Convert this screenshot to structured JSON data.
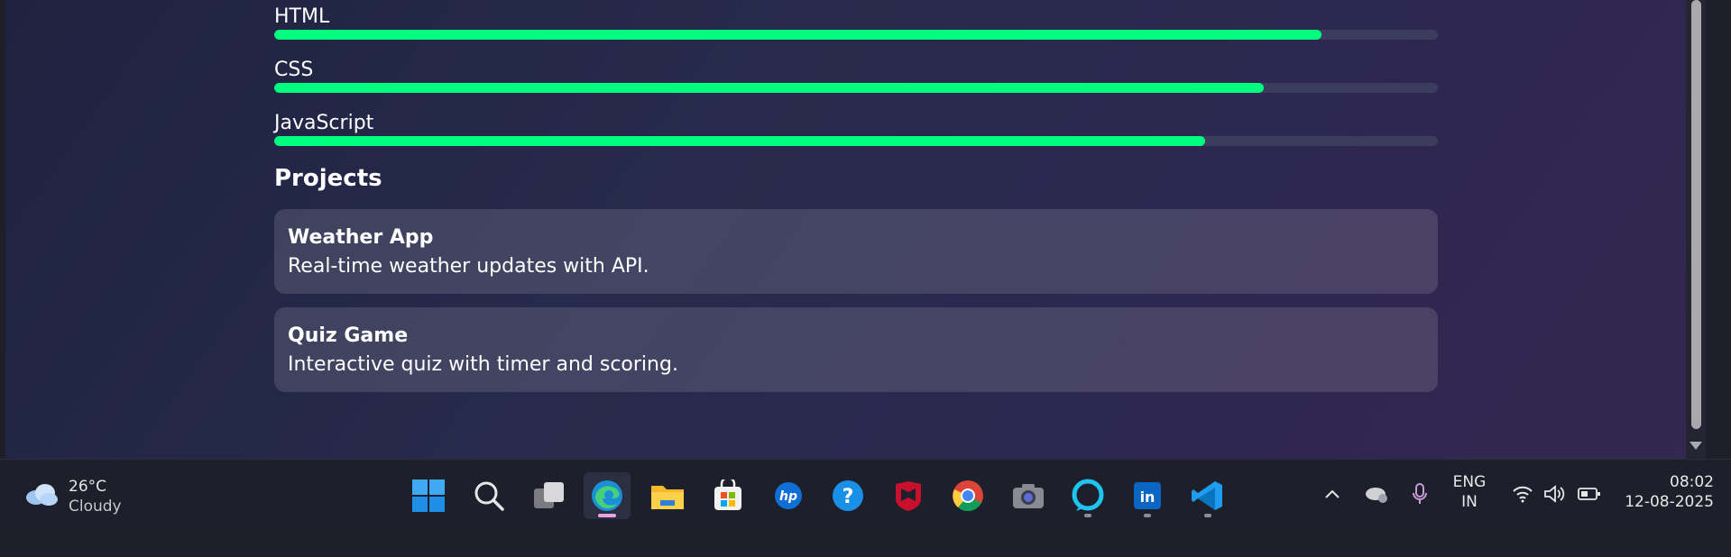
{
  "skills": [
    {
      "name": "HTML",
      "level": 0.9
    },
    {
      "name": "CSS",
      "level": 0.85
    },
    {
      "name": "JavaScript",
      "level": 0.8
    }
  ],
  "projects_title": "Projects",
  "projects": [
    {
      "name": "Weather App",
      "description": "Real-time weather updates with API."
    },
    {
      "name": "Quiz Game",
      "description": "Interactive quiz with timer and scoring."
    }
  ],
  "colors": {
    "accent": "#00ff7f",
    "track": "#3b3c5e"
  },
  "taskbar": {
    "weather": {
      "temp": "26°C",
      "condition": "Cloudy"
    },
    "apps": [
      "windows-start-icon",
      "search-icon",
      "task-view-icon",
      "edge-icon",
      "file-explorer-icon",
      "microsoft-store-icon",
      "hp-icon",
      "get-help-icon",
      "mcafee-icon",
      "chrome-icon",
      "camera-icon",
      "alexa-icon",
      "linkedin-icon",
      "vscode-icon"
    ],
    "language": {
      "line1": "ENG",
      "line2": "IN"
    },
    "time": "08:02",
    "date": "12-08-2025"
  }
}
